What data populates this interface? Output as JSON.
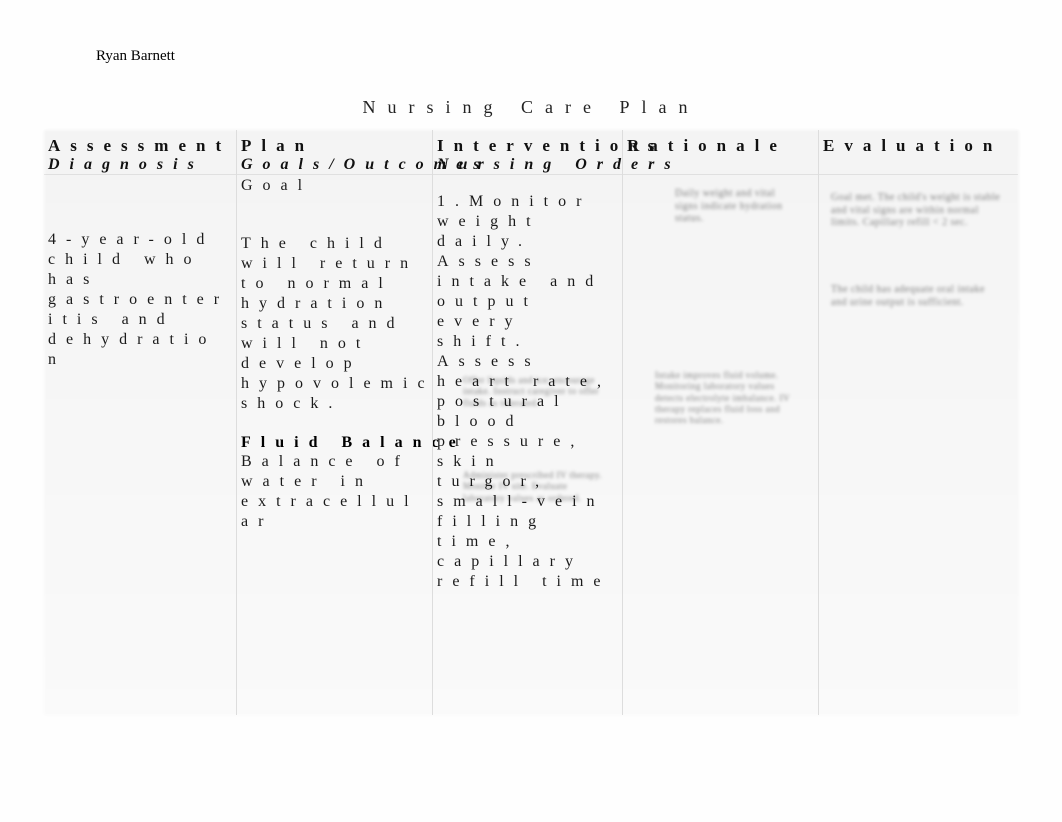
{
  "author": "Ryan Barnett",
  "title": "Nursing Care Plan",
  "columns": {
    "col1": {
      "header": "Assessment",
      "subheader": "Diagnosis"
    },
    "col2": {
      "header": "Plan",
      "subheader": "Goals/Outcomes",
      "goal_label": "Goal"
    },
    "col3": {
      "header": "Interventions",
      "subheader": "Nursing Orders"
    },
    "col4": {
      "header": "Rationale"
    },
    "col5": {
      "header": "Evaluation"
    }
  },
  "assessment_body": "4-year-old child who has gastroenteritis and dehydration",
  "goal_text": "The child will return to normal hydration status and will not develop hypovolemic shock.",
  "fluid_balance_label": "Fluid Balance",
  "fluid_balance_text": "Balance of water in extracellular",
  "interventions": {
    "item1_num": "1.",
    "item1": "Monitor weight daily. Assess intake and output every shift. Assess heart rate, postural blood pressure, skin turgor, small-vein filling time, capillary refill time",
    "item2_blur": "Offer liquids and ice; encourage intake. Instruct caregiver to offer fluids as tolerated.",
    "item3_blur": "Administer prescribed IV therapy. Monitor IV site. Evaluate laboratory values as ordered."
  },
  "rationale": {
    "item1_blur": "Daily weight and vital signs indicate hydration status.",
    "item2_blur": "Intake improves fluid volume. Monitoring laboratory values detects electrolyte imbalance. IV therapy replaces fluid loss and restores balance."
  },
  "evaluation": {
    "item1_blur": "Goal met. The child's weight is stable and vital signs are within normal limits. Capillary refill < 2 sec.",
    "item2_blur": "The child has adequate oral intake and urine output is sufficient."
  }
}
